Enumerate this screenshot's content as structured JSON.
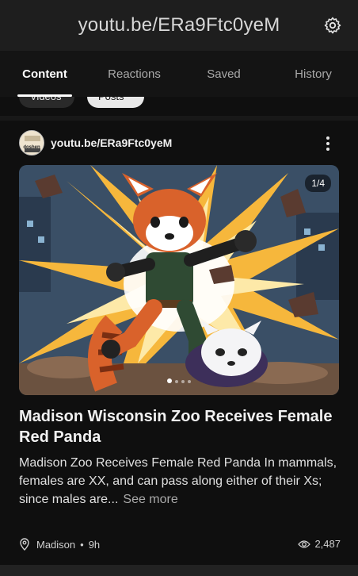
{
  "app": {
    "title": "youtu.be/ERa9Ftc0yeM"
  },
  "tabs": [
    {
      "label": "Content",
      "active": true
    },
    {
      "label": "Reactions",
      "active": false
    },
    {
      "label": "Saved",
      "active": false
    },
    {
      "label": "History",
      "active": false
    }
  ],
  "chips": {
    "videos": "Videos",
    "posts": "Posts"
  },
  "post": {
    "channel": "youtu.be/ERa9Ftc0yeM",
    "avatar_text": "doshen",
    "image_counter": "1/4",
    "title": "Madison Wisconsin Zoo Receives Female Red Panda",
    "body": "Madison Zoo Receives Female Red Panda In mammals, females are XX, and can pass along either of their Xs; since males are...",
    "see_more": "See more",
    "location": "Madison",
    "separator": "•",
    "time": "9h",
    "views": "2,487"
  },
  "icons": {
    "settings": "gear-icon",
    "more": "vertical-dots-icon",
    "location": "pin-icon",
    "views": "eye-icon"
  },
  "colors": {
    "background": "#0f0f0f",
    "appbar": "#1e1e1e",
    "tabbar": "#141414",
    "panda_orange": "#d9622b",
    "explosion_yellow": "#f6b73c"
  }
}
